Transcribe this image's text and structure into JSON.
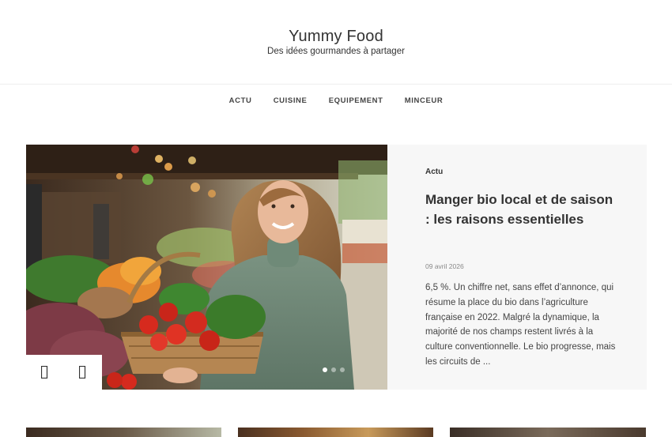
{
  "site": {
    "title": "Yummy Food",
    "description": "Des idées gourmandes à partager"
  },
  "nav": {
    "items": [
      {
        "label": "ACTU"
      },
      {
        "label": "CUISINE"
      },
      {
        "label": "EQUIPEMENT"
      },
      {
        "label": "MINCEUR"
      }
    ]
  },
  "featured": {
    "category": "Actu",
    "title": "Manger bio local et de saison : les raisons essentielles",
    "date": "09 avril 2026",
    "excerpt": "6,5 %. Un chiffre net, sans effet d’annonce, qui résume la place du bio dans l’agriculture française en 2022. Malgré la dynamique, la majorité de nos champs restent livrés à la culture conventionnelle. Le bio progresse, mais les circuits de ...",
    "image_icon": "market-woman-vegetable-basket-photo"
  },
  "slider": {
    "prev_icon": "chevron-left-icon",
    "next_icon": "chevron-right-icon",
    "slide_count": 3,
    "active_slide": 1
  },
  "colors": {
    "text": "#333333",
    "panel_bg": "#f7f7f7",
    "date": "#888888"
  }
}
